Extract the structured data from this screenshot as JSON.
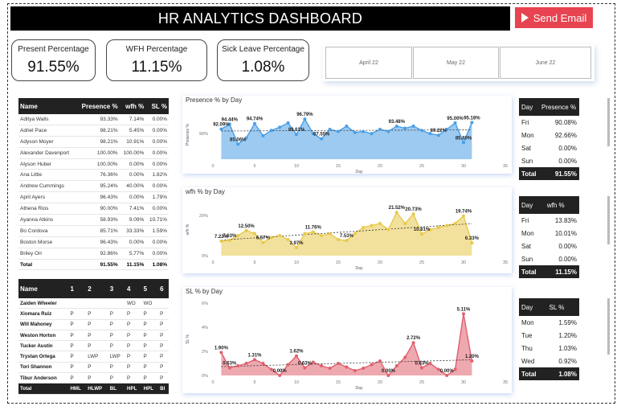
{
  "header": {
    "title": "HR ANALYTICS DASHBOARD",
    "send_email": "Send Email"
  },
  "kpis": [
    {
      "label": "Present Percentage",
      "value": "91.55%"
    },
    {
      "label": "WFH Percentage",
      "value": "11.15%"
    },
    {
      "label": "Sick Leave Percentage",
      "value": "1.08%"
    }
  ],
  "months": [
    "April 22",
    "May 22",
    "June 22"
  ],
  "employee_table": {
    "headers": [
      "Name",
      "Presence %",
      "wfh %",
      "SL %"
    ],
    "rows": [
      [
        "Aditya Walls",
        "93.33%",
        "7.14%",
        "0.00%"
      ],
      [
        "Adriel Pace",
        "98.21%",
        "5.45%",
        "0.00%"
      ],
      [
        "Adyson Moyer",
        "98.21%",
        "10.91%",
        "0.00%"
      ],
      [
        "Alexander Davenport",
        "100.00%",
        "100.00%",
        "0.00%"
      ],
      [
        "Alyson Huber",
        "100.00%",
        "0.00%",
        "0.00%"
      ],
      [
        "Ana Little",
        "76.36%",
        "0.00%",
        "1.82%"
      ],
      [
        "Andrew Cummings",
        "95.24%",
        "40.00%",
        "0.00%"
      ],
      [
        "April Ayers",
        "96.43%",
        "0.00%",
        "1.79%"
      ],
      [
        "Athena Rios",
        "90.00%",
        "7.41%",
        "0.00%"
      ],
      [
        "Ayanna Atkins",
        "58.93%",
        "9.09%",
        "10.71%"
      ],
      [
        "Bo Cordova",
        "85.71%",
        "33.33%",
        "1.59%"
      ],
      [
        "Boston Morse",
        "96.43%",
        "0.00%",
        "0.00%"
      ],
      [
        "Briley Orr",
        "92.86%",
        "5.77%",
        "0.00%"
      ]
    ],
    "total": [
      "Total",
      "91.55%",
      "11.15%",
      "1.08%"
    ]
  },
  "attendance_table": {
    "headers": [
      "Name",
      "1",
      "2",
      "3",
      "4",
      "5",
      "6"
    ],
    "rows": [
      [
        "Zaiden Wheeler",
        "",
        "",
        "",
        "WO",
        "WO",
        ""
      ],
      [
        "Xiomara Ruiz",
        "P",
        "P",
        "P",
        "P",
        "P",
        "P"
      ],
      [
        "Will Mahoney",
        "P",
        "P",
        "P",
        "P",
        "P",
        "P"
      ],
      [
        "Weston Horton",
        "P",
        "P",
        "P",
        "P",
        "P",
        "P"
      ],
      [
        "Tucker Austin",
        "P",
        "P",
        "P",
        "P",
        "P",
        "P"
      ],
      [
        "Trystan Ortega",
        "P",
        "LWP",
        "LWP",
        "P",
        "P",
        "P"
      ],
      [
        "Tori Shannon",
        "P",
        "P",
        "P",
        "P",
        "P",
        "P"
      ],
      [
        "Tibur Anderson",
        "P",
        "P",
        "P",
        "P",
        "P",
        "P"
      ]
    ],
    "total": [
      "Total",
      "HML",
      "HLWP",
      "BL",
      "HPL",
      "HPL",
      "BI"
    ]
  },
  "chart_data": [
    {
      "type": "area",
      "title": "Presence % by Day",
      "xlabel": "Day",
      "ylabel": "Presence %",
      "xlim": [
        0,
        35
      ],
      "xticks": [
        "0",
        "5",
        "10",
        "15",
        "20",
        "25",
        "30",
        "35"
      ],
      "yticks": [
        "90%"
      ],
      "ylim": [
        78,
        101
      ],
      "color": "#4a9fe6",
      "x": [
        1,
        2,
        3,
        4,
        5,
        6,
        7,
        8,
        9,
        10,
        11,
        12,
        13,
        14,
        15,
        16,
        17,
        18,
        19,
        20,
        21,
        22,
        23,
        24,
        25,
        26,
        27,
        28,
        29,
        30,
        31
      ],
      "values": [
        92.09,
        94.44,
        85.06,
        88,
        94.74,
        89,
        91.5,
        93,
        95,
        89.61,
        96.79,
        90,
        87.55,
        92,
        91,
        93.5,
        90.5,
        91,
        90,
        92,
        91,
        93.48,
        92.5,
        93.5,
        91.5,
        90,
        89.22,
        92,
        95,
        85.8,
        95.18
      ],
      "labels": [
        {
          "i": 0,
          "t": "92.09%"
        },
        {
          "i": 1,
          "t": "94.44%"
        },
        {
          "i": 2,
          "t": "85.06%"
        },
        {
          "i": 4,
          "t": "94.74%"
        },
        {
          "i": 9,
          "t": "89.61%"
        },
        {
          "i": 10,
          "t": "96.79%"
        },
        {
          "i": 12,
          "t": "87.55%"
        },
        {
          "i": 21,
          "t": "93.48%"
        },
        {
          "i": 26,
          "t": "89.22%"
        },
        {
          "i": 28,
          "t": "95.00%"
        },
        {
          "i": 29,
          "t": "85.80%"
        },
        {
          "i": 30,
          "t": "95.18%"
        }
      ]
    },
    {
      "type": "area",
      "title": "wfh % by Day",
      "xlabel": "Day",
      "ylabel": "wfh %",
      "xlim": [
        0,
        35
      ],
      "xticks": [
        "0",
        "5",
        "10",
        "15",
        "20",
        "25",
        "30",
        "35"
      ],
      "yticks": [
        "0%",
        "20%"
      ],
      "ylim": [
        0,
        26
      ],
      "color": "#e8c94a",
      "x": [
        1,
        2,
        3,
        4,
        5,
        6,
        7,
        8,
        9,
        10,
        11,
        12,
        13,
        14,
        15,
        16,
        17,
        18,
        19,
        20,
        21,
        22,
        23,
        24,
        25,
        26,
        27,
        28,
        29,
        30,
        31
      ],
      "values": [
        7.22,
        7.63,
        10,
        12.5,
        11,
        6.57,
        9,
        10,
        8,
        3.97,
        11,
        11.76,
        10,
        11,
        8,
        7.53,
        11,
        14,
        15,
        16,
        13,
        21.52,
        16,
        20.73,
        10.81,
        13,
        14,
        15,
        16,
        19.74,
        6.33
      ],
      "labels": [
        {
          "i": 0,
          "t": "7.22%"
        },
        {
          "i": 1,
          "t": "7.63%"
        },
        {
          "i": 3,
          "t": "12.50%"
        },
        {
          "i": 5,
          "t": "6.57%"
        },
        {
          "i": 9,
          "t": "3.97%"
        },
        {
          "i": 11,
          "t": "11.76%"
        },
        {
          "i": 15,
          "t": "7.53%"
        },
        {
          "i": 21,
          "t": "21.52%"
        },
        {
          "i": 23,
          "t": "20.73%"
        },
        {
          "i": 24,
          "t": "10.81%"
        },
        {
          "i": 29,
          "t": "19.74%"
        },
        {
          "i": 30,
          "t": "6.33%"
        }
      ]
    },
    {
      "type": "area",
      "title": "SL % by Day",
      "xlabel": "Day",
      "ylabel": "SL %",
      "xlim": [
        0,
        35
      ],
      "xticks": [
        "0",
        "5",
        "10",
        "15",
        "20",
        "25",
        "30",
        "35"
      ],
      "yticks": [
        "0%",
        "2%",
        "4%",
        "6%"
      ],
      "ylim": [
        0,
        6
      ],
      "color": "#e0606e",
      "x": [
        1,
        2,
        3,
        4,
        5,
        6,
        7,
        8,
        9,
        10,
        11,
        12,
        13,
        14,
        15,
        16,
        17,
        18,
        19,
        20,
        21,
        22,
        23,
        24,
        25,
        26,
        27,
        28,
        29,
        30,
        31
      ],
      "values": [
        1.9,
        0.63,
        0.8,
        1.0,
        1.31,
        1.0,
        0.5,
        0.0,
        0.9,
        1.62,
        0.63,
        1.1,
        0.8,
        0.6,
        1.0,
        0.7,
        0.4,
        0.6,
        0.9,
        1.2,
        0.0,
        0.8,
        1.5,
        2.72,
        0.63,
        1.0,
        0.5,
        0.0,
        0.5,
        5.11,
        1.2
      ],
      "labels": [
        {
          "i": 0,
          "t": "1.90%"
        },
        {
          "i": 1,
          "t": "0.63%"
        },
        {
          "i": 4,
          "t": "1.31%"
        },
        {
          "i": 7,
          "t": "0.00%"
        },
        {
          "i": 9,
          "t": "1.62%"
        },
        {
          "i": 10,
          "t": "0.63%"
        },
        {
          "i": 20,
          "t": "0.00%"
        },
        {
          "i": 23,
          "t": "2.72%"
        },
        {
          "i": 24,
          "t": "0.63%"
        },
        {
          "i": 27,
          "t": "0.00%"
        },
        {
          "i": 29,
          "t": "5.11%"
        },
        {
          "i": 30,
          "t": "1.20%"
        }
      ]
    }
  ],
  "side_tables": [
    {
      "headers": [
        "Day",
        "Presence %"
      ],
      "rows": [
        [
          "Fri",
          "90.08%"
        ],
        [
          "Mon",
          "92.66%"
        ],
        [
          "Sat",
          "0.00%"
        ],
        [
          "Sun",
          "0.00%"
        ]
      ],
      "total": [
        "Total",
        "91.55%"
      ]
    },
    {
      "headers": [
        "Day",
        "wfh %"
      ],
      "rows": [
        [
          "Fri",
          "13.83%"
        ],
        [
          "Mon",
          "10.01%"
        ],
        [
          "Sat",
          "0.00%"
        ],
        [
          "Sun",
          "0.00%"
        ]
      ],
      "total": [
        "Total",
        "11.15%"
      ]
    },
    {
      "headers": [
        "Day",
        "SL %"
      ],
      "rows": [
        [
          "Mon",
          "1.59%"
        ],
        [
          "Tue",
          "1.20%"
        ],
        [
          "Thu",
          "1.03%"
        ],
        [
          "Wed",
          "0.92%"
        ]
      ],
      "total": [
        "Total",
        "1.08%"
      ]
    }
  ]
}
